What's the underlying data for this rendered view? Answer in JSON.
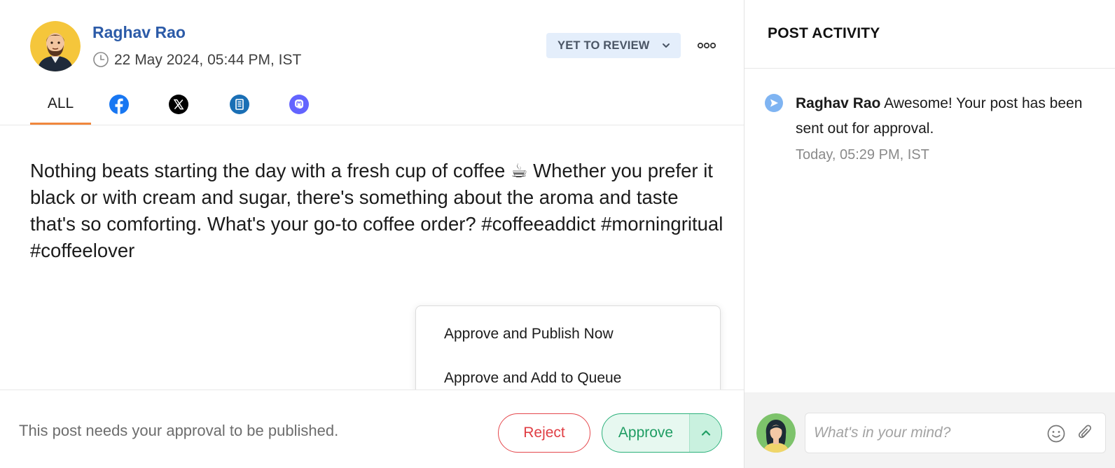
{
  "post": {
    "author": "Raghav Rao",
    "timestamp": "22 May 2024, 05:44 PM, IST",
    "status": "YET TO REVIEW",
    "body": "Nothing beats starting the day with a fresh cup of coffee ☕ Whether you prefer it black or with cream and sugar, there's something about the aroma and taste that's so comforting. What's your go-to coffee order? #coffeeaddict #morningritual #coffeelover"
  },
  "tabs": [
    {
      "label": "ALL",
      "icon": "",
      "active": true
    },
    {
      "label": "",
      "icon": "facebook-icon",
      "color": "#1877f2"
    },
    {
      "label": "",
      "icon": "x-icon",
      "color": "#000000"
    },
    {
      "label": "",
      "icon": "document-icon",
      "color": "#1a6fb5"
    },
    {
      "label": "",
      "icon": "mastodon-icon",
      "color": "#6364ff"
    }
  ],
  "approve_menu": {
    "items": [
      "Approve and Publish Now",
      "Approve and Add to Queue"
    ]
  },
  "footer": {
    "message": "This post needs your approval to be published.",
    "reject_label": "Reject",
    "approve_label": "Approve"
  },
  "activity": {
    "title": "POST ACTIVITY",
    "entries": [
      {
        "user": "Raghav Rao",
        "text": "Awesome! Your post has been sent out for approval.",
        "time": "Today, 05:29 PM, IST",
        "icon": "send-icon"
      }
    ]
  },
  "comment": {
    "placeholder": "What's in your mind?"
  },
  "colors": {
    "accent_orange": "#f0873d",
    "author_blue": "#2c5ba8",
    "reject_red": "#e03e44",
    "approve_green": "#1f9d63",
    "status_bg": "#e4eefb"
  }
}
